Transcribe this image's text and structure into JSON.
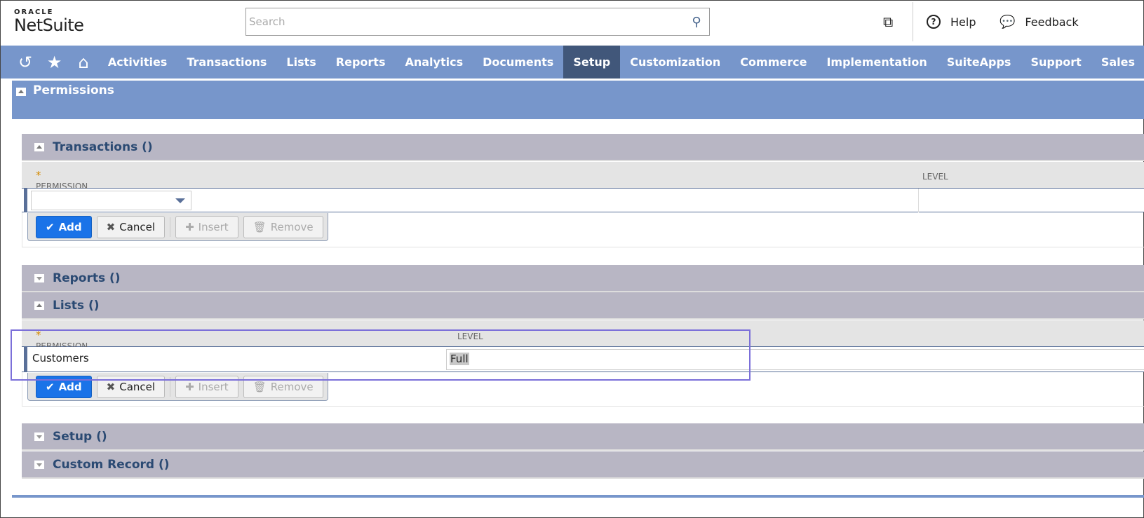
{
  "header": {
    "logo_top": "ORACLE",
    "logo_bottom": "NetSuite",
    "search_placeholder": "Search",
    "help": "Help",
    "feedback": "Feedback"
  },
  "nav": {
    "items": [
      "Activities",
      "Transactions",
      "Lists",
      "Reports",
      "Analytics",
      "Documents",
      "Setup",
      "Customization",
      "Commerce",
      "Implementation",
      "SuiteApps",
      "Support",
      "Sales"
    ],
    "active": "Setup"
  },
  "permissions_title": "Permissions",
  "sections": {
    "transactions": {
      "title": "Transactions ()",
      "col_permission": "PERMISSION",
      "col_level": "LEVEL",
      "required": "*"
    },
    "reports": {
      "title": "Reports ()"
    },
    "lists": {
      "title": "Lists ()",
      "col_permission": "PERMISSION",
      "col_level": "LEVEL",
      "required": "*",
      "row_permission": "Customers",
      "row_level": "Full"
    },
    "setup": {
      "title": "Setup ()"
    },
    "custom_record": {
      "title": "Custom Record ()"
    }
  },
  "buttons": {
    "add": "Add",
    "cancel": "Cancel",
    "insert": "Insert",
    "remove": "Remove"
  },
  "colors": {
    "nav": "#7796cb",
    "active_nav": "#41577a",
    "section": "#b8b6c4",
    "highlight": "#7b6fd9",
    "add_button": "#1a73e8"
  }
}
